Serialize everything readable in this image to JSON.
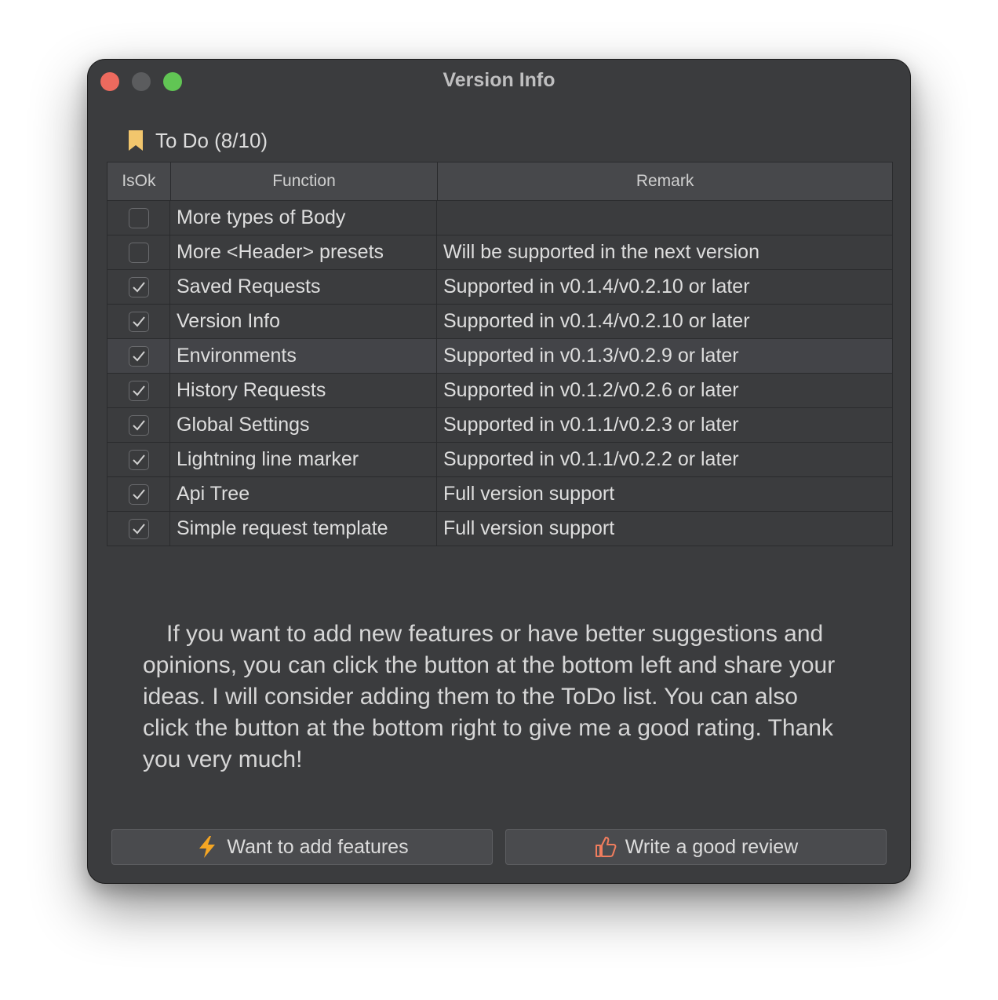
{
  "window": {
    "title": "Version Info"
  },
  "todo": {
    "title": "To Do (8/10)"
  },
  "table": {
    "headers": {
      "isok": "IsOk",
      "function": "Function",
      "remark": "Remark"
    },
    "rows": [
      {
        "checked": false,
        "function": "More types of Body",
        "remark": ""
      },
      {
        "checked": false,
        "function": "More <Header> presets",
        "remark": "Will be supported in the next version"
      },
      {
        "checked": true,
        "function": "Saved Requests",
        "remark": "Supported in v0.1.4/v0.2.10 or later"
      },
      {
        "checked": true,
        "function": "Version Info",
        "remark": "Supported in v0.1.4/v0.2.10 or later"
      },
      {
        "checked": true,
        "function": "Environments",
        "remark": "Supported in v0.1.3/v0.2.9 or later",
        "selected": true
      },
      {
        "checked": true,
        "function": "History Requests",
        "remark": "Supported in v0.1.2/v0.2.6 or later"
      },
      {
        "checked": true,
        "function": "Global Settings",
        "remark": "Supported in v0.1.1/v0.2.3 or later"
      },
      {
        "checked": true,
        "function": "Lightning line marker",
        "remark": "Supported in v0.1.1/v0.2.2 or later"
      },
      {
        "checked": true,
        "function": "Api Tree",
        "remark": "Full version support"
      },
      {
        "checked": true,
        "function": "Simple request template",
        "remark": "Full version support"
      }
    ]
  },
  "message": "If you want to add new features or have better suggestions and opinions, you can click the button at the bottom left and share your ideas. I will consider adding them to the ToDo list. You can also click the button at the bottom right to give me a good rating. Thank you very much!",
  "buttons": {
    "add_features": {
      "label": "Want to add features",
      "icon": "lightning-icon"
    },
    "review": {
      "label": "Write a good review",
      "icon": "thumbs-up-icon"
    }
  },
  "colors": {
    "close": "#ed6a5e",
    "minimize": "#5b5c5e",
    "zoom": "#61c554",
    "bookmark": "#f2c66d",
    "lightning": "#f5a623",
    "thumbs_up": "#f07d5e"
  }
}
